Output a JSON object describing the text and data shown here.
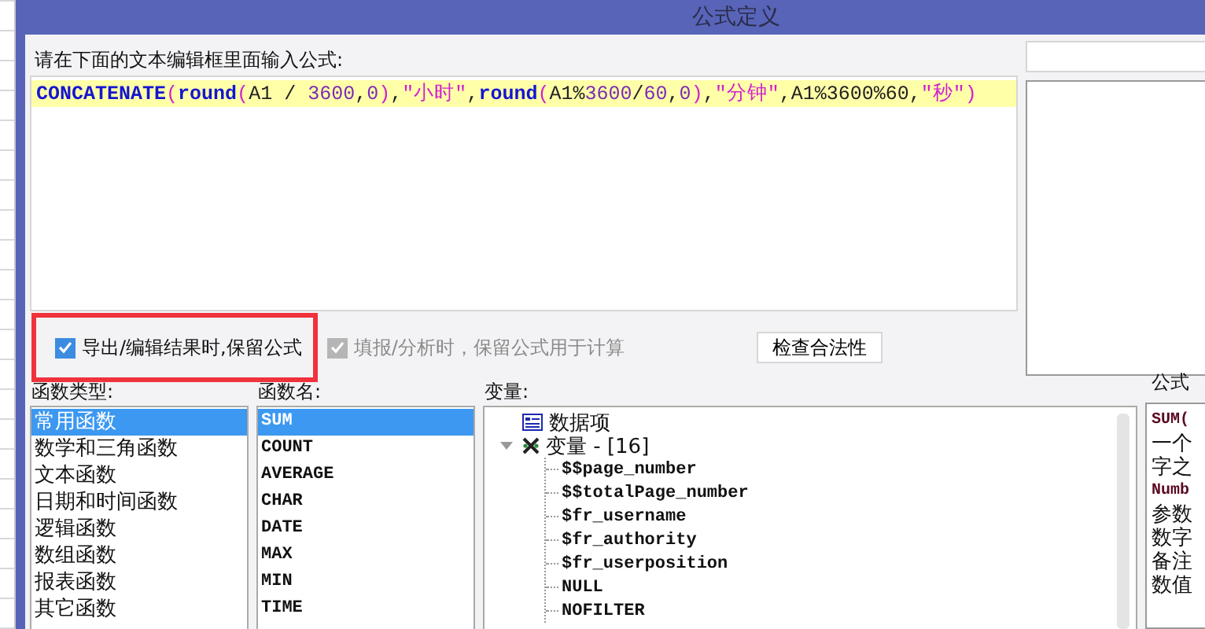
{
  "window": {
    "title": "公式定义"
  },
  "editor": {
    "label": "请在下面的文本编辑框里面输入公式:",
    "tokens": [
      {
        "text": "CONCATENATE",
        "kind": "function"
      },
      {
        "text": "(",
        "kind": "paren"
      },
      {
        "text": "round",
        "kind": "function"
      },
      {
        "text": "(",
        "kind": "paren"
      },
      {
        "text": "A1 / ",
        "kind": "plain"
      },
      {
        "text": "3600",
        "kind": "number"
      },
      {
        "text": ",",
        "kind": "plain"
      },
      {
        "text": "0",
        "kind": "number"
      },
      {
        "text": ")",
        "kind": "paren"
      },
      {
        "text": ",",
        "kind": "plain"
      },
      {
        "text": "\"小时\"",
        "kind": "string"
      },
      {
        "text": ",",
        "kind": "plain"
      },
      {
        "text": "round",
        "kind": "function"
      },
      {
        "text": "(",
        "kind": "paren"
      },
      {
        "text": "A1%",
        "kind": "plain"
      },
      {
        "text": "3600",
        "kind": "number"
      },
      {
        "text": "/",
        "kind": "plain"
      },
      {
        "text": "60",
        "kind": "number"
      },
      {
        "text": ",",
        "kind": "plain"
      },
      {
        "text": "0",
        "kind": "number"
      },
      {
        "text": ")",
        "kind": "paren"
      },
      {
        "text": ",",
        "kind": "plain"
      },
      {
        "text": "\"分钟\"",
        "kind": "string"
      },
      {
        "text": ",A1%3600%60,",
        "kind": "plain"
      },
      {
        "text": "\"秒\"",
        "kind": "string"
      },
      {
        "text": ")",
        "kind": "paren"
      }
    ]
  },
  "options": [
    {
      "label": "导出/编辑结果时,保留公式",
      "checked": true,
      "disabled": false,
      "highlighted": true
    },
    {
      "label": "填报/分析时，保留公式用于计算",
      "checked": true,
      "disabled": true,
      "highlighted": false
    }
  ],
  "check_button": "检查合法性",
  "function_types": {
    "label": "函数类型:",
    "items": [
      {
        "label": "常用函数",
        "selected": true
      },
      {
        "label": "数学和三角函数",
        "selected": false
      },
      {
        "label": "文本函数",
        "selected": false
      },
      {
        "label": "日期和时间函数",
        "selected": false
      },
      {
        "label": "逻辑函数",
        "selected": false
      },
      {
        "label": "数组函数",
        "selected": false
      },
      {
        "label": "报表函数",
        "selected": false
      },
      {
        "label": "其它函数",
        "selected": false
      }
    ]
  },
  "function_names": {
    "label": "函数名:",
    "items": [
      {
        "label": "SUM",
        "selected": true
      },
      {
        "label": "COUNT",
        "selected": false
      },
      {
        "label": "AVERAGE",
        "selected": false
      },
      {
        "label": "CHAR",
        "selected": false
      },
      {
        "label": "DATE",
        "selected": false
      },
      {
        "label": "MAX",
        "selected": false
      },
      {
        "label": "MIN",
        "selected": false
      },
      {
        "label": "TIME",
        "selected": false
      }
    ]
  },
  "variables": {
    "label": "变量:",
    "items": [
      {
        "label": "数据项",
        "kind": "dataset"
      },
      {
        "label": "变量 - [16]",
        "kind": "group",
        "expanded": true,
        "children": [
          {
            "label": "$$page_number"
          },
          {
            "label": "$$totalPage_number"
          },
          {
            "label": "$fr_username"
          },
          {
            "label": "$fr_authority"
          },
          {
            "label": "$fr_userposition"
          },
          {
            "label": "NULL"
          },
          {
            "label": "NOFILTER"
          }
        ]
      }
    ]
  },
  "description": {
    "label": "公式",
    "lines": [
      {
        "text": "SUM(",
        "kind": "code"
      },
      {
        "text": "一个",
        "kind": "text"
      },
      {
        "text": "字之",
        "kind": "text"
      },
      {
        "text": "Numb",
        "kind": "code"
      },
      {
        "text": "参数",
        "kind": "text"
      },
      {
        "text": "数字",
        "kind": "text"
      },
      {
        "text": "备注",
        "kind": "text"
      },
      {
        "text": "数值",
        "kind": "text"
      }
    ]
  }
}
